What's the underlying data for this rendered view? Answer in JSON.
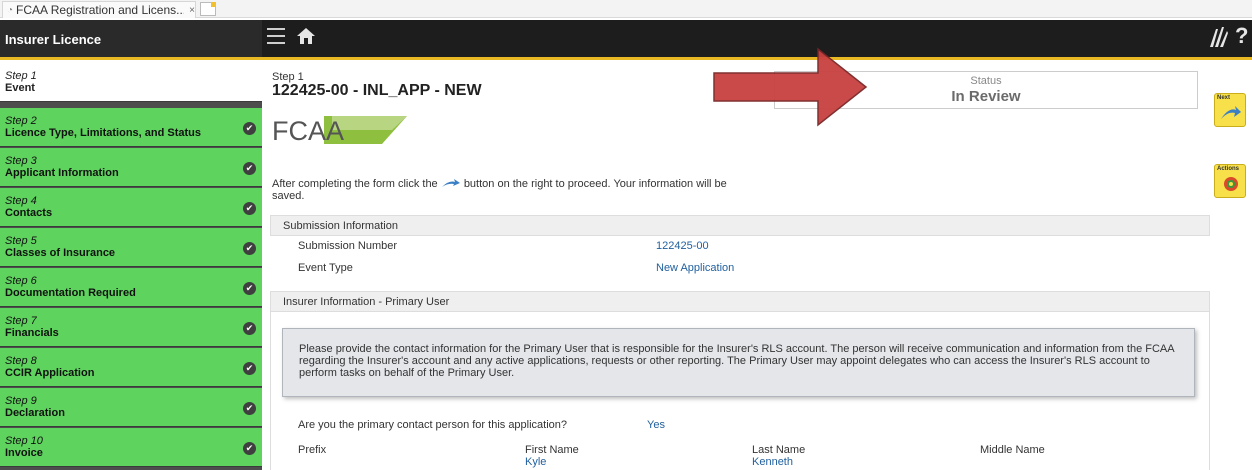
{
  "browser": {
    "tab_title": "FCAA Registration and Licens...",
    "tab_close": "×"
  },
  "header": {
    "app_title": "Insurer Licence",
    "help": "?"
  },
  "sidebar": {
    "steps": [
      {
        "num": "Step 1",
        "name": "Event",
        "state": "active"
      },
      {
        "num": "Step 2",
        "name": "Licence Type, Limitations, and Status",
        "state": "done"
      },
      {
        "num": "Step 3",
        "name": "Applicant Information",
        "state": "done"
      },
      {
        "num": "Step 4",
        "name": "Contacts",
        "state": "done"
      },
      {
        "num": "Step 5",
        "name": "Classes of Insurance",
        "state": "done"
      },
      {
        "num": "Step 6",
        "name": "Documentation Required",
        "state": "done"
      },
      {
        "num": "Step 7",
        "name": "Financials",
        "state": "done"
      },
      {
        "num": "Step 8",
        "name": "CCIR Application",
        "state": "done"
      },
      {
        "num": "Step 9",
        "name": "Declaration",
        "state": "done"
      },
      {
        "num": "Step 10",
        "name": "Invoice",
        "state": "done"
      }
    ],
    "check_glyph": "✔"
  },
  "main": {
    "step_label": "Step 1",
    "title": "122425-00 - INL_APP - NEW",
    "status_label": "Status",
    "status_value": "In Review",
    "logo_text": "FCAA",
    "instructions_before": "After completing the form click the",
    "instructions_after": "button on the right to proceed. Your information will be saved.",
    "submission_info": {
      "header": "Submission Information",
      "rows": [
        {
          "label": "Submission Number",
          "value": "122425-00"
        },
        {
          "label": "Event Type",
          "value": "New Application"
        }
      ]
    },
    "insurer_info": {
      "header": "Insurer Information - Primary User",
      "notice": "Please provide the contact information for the Primary User that is responsible for the Insurer's RLS account. The person will receive communication and information from the FCAA regarding the Insurer's account and any active applications, requests or other reporting. The Primary User may appoint delegates who can access the Insurer's RLS account to perform tasks on behalf of the Primary User.",
      "question": "Are you the primary contact person for this application?",
      "answer": "Yes",
      "name_fields": [
        {
          "label": "Prefix",
          "value": ""
        },
        {
          "label": "First Name",
          "value": "Kyle"
        },
        {
          "label": "Last Name",
          "value": "Kenneth"
        },
        {
          "label": "Middle Name",
          "value": ""
        }
      ]
    }
  },
  "actions": {
    "next_label": "Next",
    "actions_label": "Actions"
  },
  "colors": {
    "step_done": "#5ed35e",
    "header_bg": "#1d1d1d",
    "accent_yellow": "#e8b923",
    "link_blue": "#1f5f9e",
    "arrow_red": "#c84040"
  }
}
